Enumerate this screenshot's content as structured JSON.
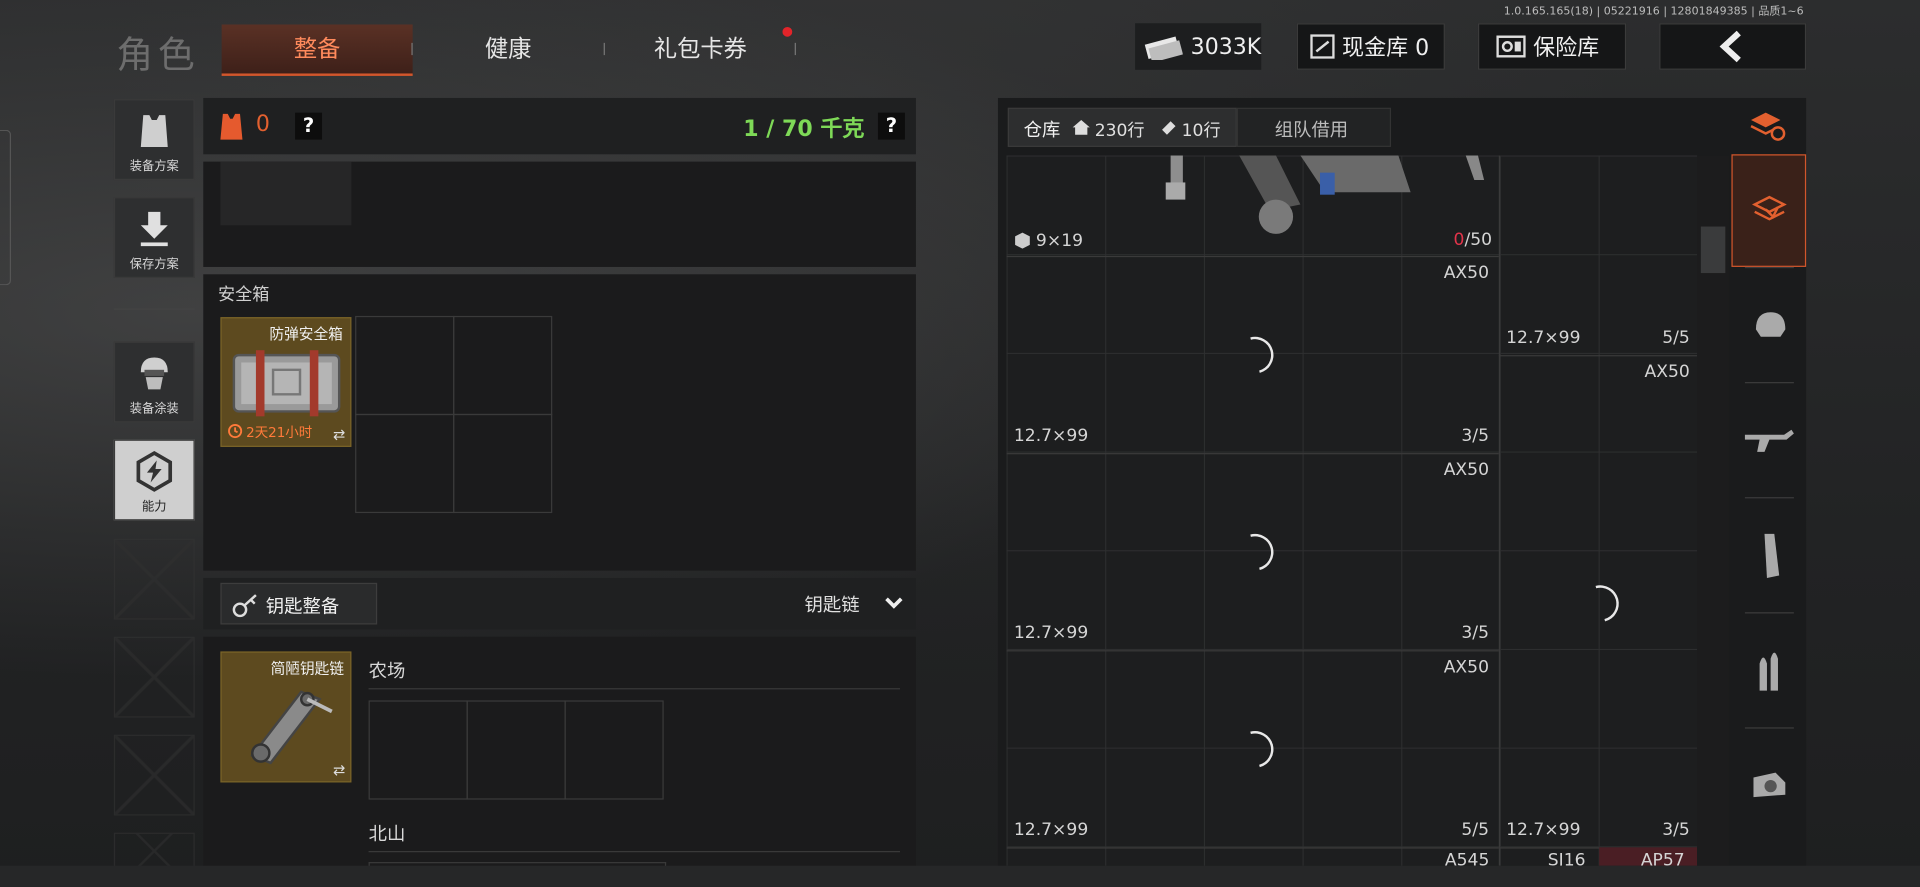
{
  "version": "1.0.165.165(18) | 05221916 | 12801849385 | 品质1~6",
  "header": {
    "title": "角色",
    "tabs": [
      {
        "label": "整备",
        "active": true
      },
      {
        "label": "健康",
        "active": false
      },
      {
        "label": "礼包卡券",
        "active": false,
        "notify": true
      }
    ],
    "currency": "3033K",
    "cash_vault": "现金库 0",
    "safe_vault": "保险库"
  },
  "sidebar": {
    "items": [
      {
        "label": "装备方案"
      },
      {
        "label": "保存方案"
      },
      {
        "label": "装备涂装"
      },
      {
        "label": "能力"
      }
    ]
  },
  "loadout": {
    "armor_count": "0",
    "weight": "1 / 70 千克",
    "help": "?",
    "safebox": {
      "title": "安全箱",
      "item_name": "防弹安全箱",
      "timer": "2天21小时"
    },
    "keys": {
      "button": "钥匙整备",
      "dropdown": "钥匙链",
      "item_name": "简陋钥匙链",
      "section1": "农场",
      "section2": "北山"
    }
  },
  "warehouse": {
    "label": "仓库",
    "rows": "230行",
    "rows2": "10行",
    "team_borrow": "组队借用",
    "cells": [
      {
        "caliber": "9×19",
        "count_red": "0",
        "count": "/50"
      },
      {
        "name": "AX50",
        "caliber": "12.7×99",
        "count": "3/5"
      },
      {
        "name": "",
        "caliber": "12.7×99",
        "count": "5/5"
      },
      {
        "name": "AX50"
      },
      {
        "name": "AX50",
        "caliber": "12.7×99",
        "count": "3/5"
      },
      {
        "name": "AX50",
        "caliber": "12.7×99",
        "count": "5/5"
      },
      {
        "caliber": "12.7×99",
        "count": "3/5"
      },
      {
        "name": "A545"
      },
      {
        "name": "SJ16"
      },
      {
        "name": "AP57"
      }
    ]
  },
  "colors": {
    "accent": "#d2562c",
    "green": "#7ed957",
    "red": "#e2344a",
    "gold": "#5d4a1f"
  }
}
